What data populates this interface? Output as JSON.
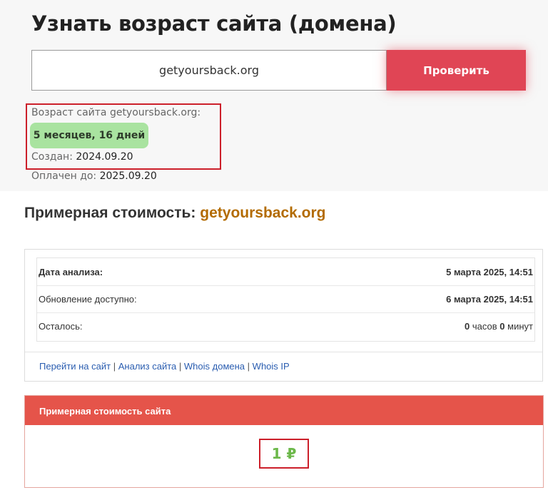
{
  "header": {
    "title": "Узнать возраст сайта (домена)"
  },
  "search": {
    "value": "getyoursback.org",
    "button_label": "Проверить"
  },
  "result": {
    "age_label": "Возраст сайта getyoursback.org:",
    "age_value": "5 месяцев, 16 дней",
    "created_label": "Создан:",
    "created_value": "2024.09.20",
    "paid_label": "Оплачен до:",
    "paid_value": "2025.09.20"
  },
  "estimate": {
    "heading_prefix": "Примерная стоимость:",
    "heading_domain": "getyoursback.org",
    "rows": [
      {
        "label": "Дата анализа:",
        "value": "5 марта 2025, 14:51"
      },
      {
        "label": "Обновление доступно:",
        "value": "6 марта 2025, 14:51"
      },
      {
        "label": "Осталось:",
        "value_hours": "0",
        "hours_word": "часов",
        "value_minutes": "0",
        "minutes_word": "минут"
      }
    ],
    "links": [
      "Перейти на сайт",
      "Анализ сайта",
      "Whois домена",
      "Whois IP"
    ],
    "link_separator": "|"
  },
  "cost": {
    "header": "Примерная стоимость сайта",
    "value": "1 ₽"
  },
  "colors": {
    "accent": "#e04555",
    "badge": "#a9e3a0",
    "highlight_domain": "#b36b00",
    "cost_header": "#e5544a",
    "cost_value": "#6cb84a",
    "annotation_box": "#cc1f2a"
  }
}
